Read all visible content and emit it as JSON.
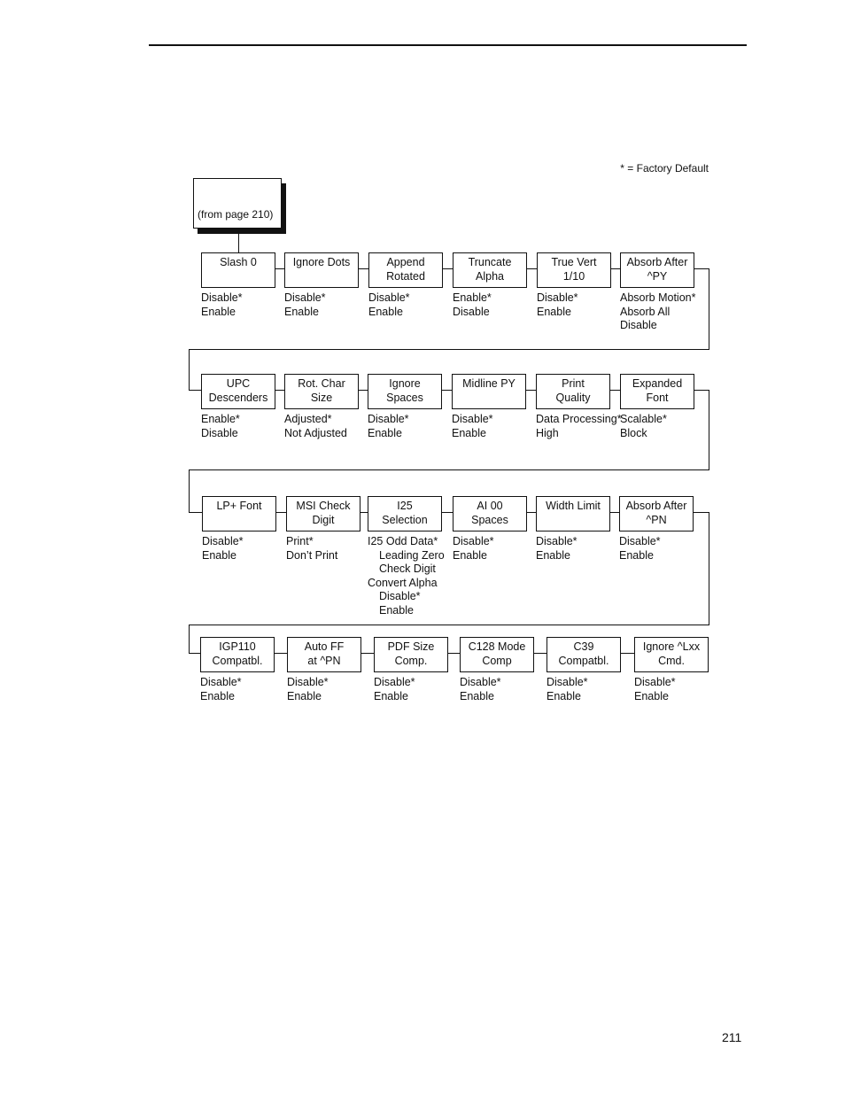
{
  "legend": "* = Factory Default",
  "from_box": "(from page 210)",
  "page_number": "211",
  "rows": [
    [
      {
        "label": [
          "Slash 0"
        ],
        "options": [
          {
            "text": "Disable*"
          },
          {
            "text": "Enable"
          }
        ]
      },
      {
        "label": [
          "Ignore Dots"
        ],
        "options": [
          {
            "text": "Disable*"
          },
          {
            "text": "Enable"
          }
        ]
      },
      {
        "label": [
          "Append",
          "Rotated"
        ],
        "options": [
          {
            "text": "Disable*"
          },
          {
            "text": "Enable"
          }
        ]
      },
      {
        "label": [
          "Truncate",
          "Alpha"
        ],
        "options": [
          {
            "text": "Enable*"
          },
          {
            "text": "Disable"
          }
        ]
      },
      {
        "label": [
          "True Vert",
          "1/10"
        ],
        "options": [
          {
            "text": "Disable*"
          },
          {
            "text": "Enable"
          }
        ]
      },
      {
        "label": [
          "Absorb After",
          "^PY"
        ],
        "options": [
          {
            "text": "Absorb Motion*"
          },
          {
            "text": "Absorb All"
          },
          {
            "text": "Disable"
          }
        ]
      }
    ],
    [
      {
        "label": [
          "UPC",
          "Descenders"
        ],
        "options": [
          {
            "text": "Enable*"
          },
          {
            "text": "Disable"
          }
        ]
      },
      {
        "label": [
          "Rot. Char",
          "Size"
        ],
        "options": [
          {
            "text": "Adjusted*"
          },
          {
            "text": "Not Adjusted"
          }
        ]
      },
      {
        "label": [
          "Ignore",
          "Spaces"
        ],
        "options": [
          {
            "text": "Disable*"
          },
          {
            "text": "Enable"
          }
        ]
      },
      {
        "label": [
          "Midline PY"
        ],
        "options": [
          {
            "text": "Disable*"
          },
          {
            "text": "Enable"
          }
        ]
      },
      {
        "label": [
          "Print",
          "Quality"
        ],
        "options": [
          {
            "text": "Data Processing*"
          },
          {
            "text": "High"
          }
        ]
      },
      {
        "label": [
          "Expanded",
          "Font"
        ],
        "options": [
          {
            "text": "Scalable*"
          },
          {
            "text": "Block"
          }
        ]
      }
    ],
    [
      {
        "label": [
          "LP+ Font"
        ],
        "options": [
          {
            "text": "Disable*"
          },
          {
            "text": "Enable"
          }
        ]
      },
      {
        "label": [
          "MSI Check",
          "Digit"
        ],
        "options": [
          {
            "text": "Print*"
          },
          {
            "text": "Don’t Print"
          }
        ]
      },
      {
        "label": [
          "I25",
          "Selection"
        ],
        "options": [
          {
            "text": "I25 Odd Data*"
          },
          {
            "text": "Leading Zero",
            "level": 1
          },
          {
            "text": "Check Digit",
            "level": 1
          },
          {
            "text": "Convert Alpha"
          },
          {
            "text": "Disable*",
            "level": 1
          },
          {
            "text": "Enable",
            "level": 1
          }
        ]
      },
      {
        "label": [
          "AI 00",
          "Spaces"
        ],
        "options": [
          {
            "text": "Disable*"
          },
          {
            "text": "Enable"
          }
        ]
      },
      {
        "label": [
          "Width Limit"
        ],
        "options": [
          {
            "text": "Disable*"
          },
          {
            "text": "Enable"
          }
        ]
      },
      {
        "label": [
          "Absorb After",
          "^PN"
        ],
        "options": [
          {
            "text": "Disable*"
          },
          {
            "text": "Enable"
          }
        ]
      }
    ],
    [
      {
        "label": [
          "IGP110",
          "Compatbl."
        ],
        "options": [
          {
            "text": "Disable*"
          },
          {
            "text": "Enable"
          }
        ]
      },
      {
        "label": [
          "Auto FF",
          "at ^PN"
        ],
        "options": [
          {
            "text": "Disable*"
          },
          {
            "text": "Enable"
          }
        ]
      },
      {
        "label": [
          "PDF Size",
          "Comp."
        ],
        "options": [
          {
            "text": "Disable*"
          },
          {
            "text": "Enable"
          }
        ]
      },
      {
        "label": [
          "C128 Mode",
          "Comp"
        ],
        "options": [
          {
            "text": "Disable*"
          },
          {
            "text": "Enable"
          }
        ]
      },
      {
        "label": [
          "C39",
          "Compatbl."
        ],
        "options": [
          {
            "text": "Disable*"
          },
          {
            "text": "Enable"
          }
        ]
      },
      {
        "label": [
          "Ignore ^Lxx",
          "Cmd."
        ],
        "options": [
          {
            "text": "Disable*"
          },
          {
            "text": "Enable"
          }
        ]
      }
    ]
  ]
}
